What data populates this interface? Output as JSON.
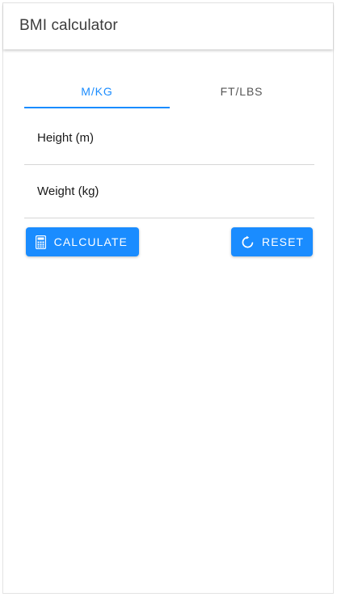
{
  "app": {
    "title": "BMI calculator"
  },
  "tabs": [
    {
      "label": "M/KG",
      "active": true
    },
    {
      "label": "FT/LBS",
      "active": false
    }
  ],
  "form": {
    "height_placeholder": "Height (m)",
    "height_value": "",
    "weight_placeholder": "Weight (kg)",
    "weight_value": ""
  },
  "actions": {
    "calculate_label": "CALCULATE",
    "calculate_icon": "calculator-icon",
    "reset_label": "RESET",
    "reset_icon": "refresh-icon"
  },
  "colors": {
    "accent": "#1a8cff",
    "tab_inactive": "#555555",
    "button_bg": "#1a8cff",
    "button_text": "#ffffff"
  }
}
